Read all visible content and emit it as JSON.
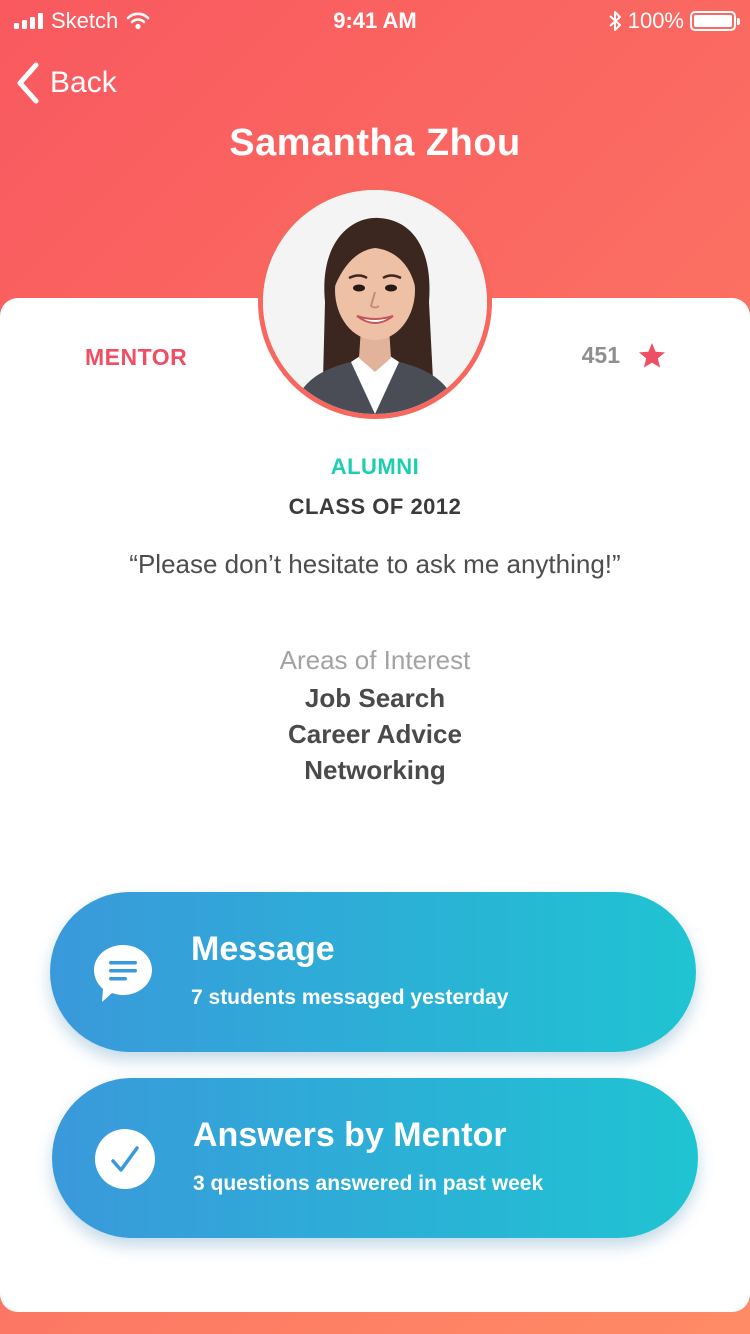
{
  "status_bar": {
    "carrier": "Sketch",
    "time": "9:41 AM",
    "battery": "100%"
  },
  "nav": {
    "back_label": "Back",
    "title": "Samantha Zhou"
  },
  "profile": {
    "role": "MENTOR",
    "rating": "451",
    "group": "ALUMNI",
    "class_year": "CLASS OF 2012",
    "quote": "“Please don’t hesitate to ask me anything!”",
    "interests_heading": "Areas of Interest",
    "interests": [
      "Job Search",
      "Career Advice",
      "Networking"
    ]
  },
  "actions": [
    {
      "title": "Message",
      "subtitle": "7 students messaged yesterday",
      "icon": "chat-bubble-icon"
    },
    {
      "title": "Answers by Mentor",
      "subtitle": "3 questions answered in past week",
      "icon": "checkmark-icon"
    }
  ],
  "colors": {
    "header_gradient_start": "#f9595f",
    "header_gradient_end": "#ff8b66",
    "accent_pink": "#ef4f63",
    "accent_teal": "#1ccfb2",
    "button_start": "#3a99db",
    "button_end": "#1fc4d2"
  }
}
